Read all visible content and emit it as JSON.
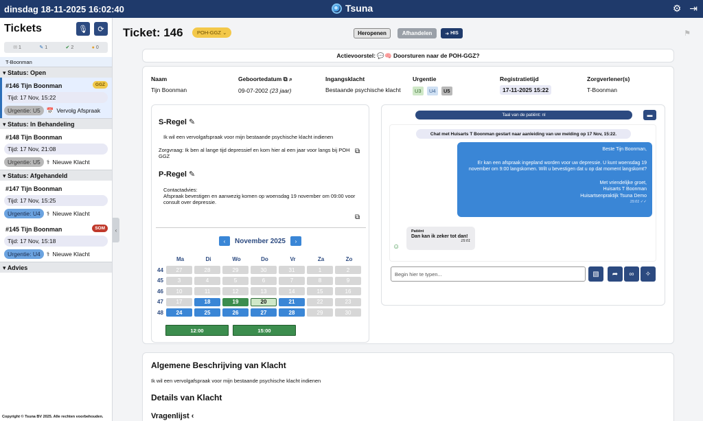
{
  "topbar": {
    "datetime": "dinsdag 18-11-2025 16:02:40",
    "app_name": "Tsuna"
  },
  "sidebar": {
    "title": "Tickets",
    "counters": {
      "mail": "1",
      "edit": "1",
      "ok": "2",
      "lock": "0"
    },
    "user": "T-Boonman",
    "sections": {
      "open": "Status: Open",
      "behandeling": "Status: In Behandeling",
      "afgehandeld": "Status: Afgehandeld",
      "advies": "Advies"
    },
    "tickets": [
      {
        "name": "#146 Tijn Boonman",
        "time": "Tijd: 17 Nov, 15:22",
        "urgency": "Urgentie: U5",
        "type": "Vervolg Afspraak",
        "badge": "GGZ"
      },
      {
        "name": "#148 Tijn Boonman",
        "time": "Tijd: 17 Nov, 21:08",
        "urgency": "Urgentie: U5",
        "type": "Nieuwe Klacht",
        "badge": ""
      },
      {
        "name": "#147 Tijn Boonman",
        "time": "Tijd: 17 Nov, 15:25",
        "urgency": "Urgentie: U4",
        "type": "Nieuwe Klacht",
        "badge": ""
      },
      {
        "name": "#145 Tijn Boonman",
        "time": "Tijd: 17 Nov, 15:18",
        "urgency": "Urgentie: U4",
        "type": "Nieuwe Klacht",
        "badge": "SOM"
      }
    ],
    "copyright": "Copyright © Tsuna BV 2025. Alle rechten voorbehouden."
  },
  "ticket": {
    "title": "Ticket: 146",
    "badge": "POH-GGZ",
    "buttons": {
      "heropen": "Heropenen",
      "afhandelen": "Afhandelen",
      "his": "HIS"
    },
    "actievoorstel": "Actievoorstel: 💬🧠 Doorsturen naar de POH-GGZ?"
  },
  "info": {
    "labels": {
      "naam": "Naam",
      "geboortedatum": "Geboortedatum",
      "ingangsklacht": "Ingangsklacht",
      "urgentie": "Urgentie",
      "registratietijd": "Registratietijd",
      "zorgverlener": "Zorgverlener(s)"
    },
    "naam": "Tijn Boonman",
    "geboortedatum": "09-07-2002",
    "leeftijd": "(23 jaar)",
    "ingangsklacht": "Bestaande psychische klacht",
    "urgentie_levels": [
      "U3",
      "U4",
      "U5"
    ],
    "registratietijd": "17-11-2025 15:22",
    "zorgverlener": "T-Boonman"
  },
  "sregel": {
    "title": "S-Regel",
    "line1": "Ik wil een vervolgafspraak voor mijn bestaande psychische klacht indienen",
    "line2": "Zorgvraag: Ik ben al lange tijd depressief en kom hier al een jaar voor langs bij POH GGZ"
  },
  "pregel": {
    "title": "P-Regel",
    "line1": "Contactadvies:",
    "line2": "Afspraak bevestigen en aanwezig komen op woensdag 19 november om 09:00 voor consult over depressie."
  },
  "calendar": {
    "month": "November 2025",
    "day_headers": [
      "Ma",
      "Di",
      "Wo",
      "Do",
      "Vr",
      "Za",
      "Zo"
    ],
    "weeks": [
      {
        "wk": "44",
        "days": [
          [
            "27",
            "cur"
          ],
          [
            "28",
            "cur"
          ],
          [
            "29",
            "cur"
          ],
          [
            "30",
            "cur"
          ],
          [
            "31",
            "cur"
          ],
          [
            "1",
            "cur"
          ],
          [
            "2",
            "cur"
          ]
        ]
      },
      {
        "wk": "45",
        "days": [
          [
            "3",
            "cur"
          ],
          [
            "4",
            "cur"
          ],
          [
            "5",
            "cur"
          ],
          [
            "6",
            "cur"
          ],
          [
            "7",
            "cur"
          ],
          [
            "8",
            "cur"
          ],
          [
            "9",
            "cur"
          ]
        ]
      },
      {
        "wk": "46",
        "days": [
          [
            "10",
            "cur"
          ],
          [
            "11",
            "cur"
          ],
          [
            "12",
            "cur"
          ],
          [
            "13",
            "cur"
          ],
          [
            "14",
            "cur"
          ],
          [
            "15",
            "cur"
          ],
          [
            "16",
            "cur"
          ]
        ]
      },
      {
        "wk": "47",
        "days": [
          [
            "17",
            "cur"
          ],
          [
            "18",
            "avail"
          ],
          [
            "19",
            "green"
          ],
          [
            "20",
            "sel"
          ],
          [
            "21",
            "avail"
          ],
          [
            "22",
            "cur"
          ],
          [
            "23",
            "cur"
          ]
        ]
      },
      {
        "wk": "48",
        "days": [
          [
            "24",
            "avail"
          ],
          [
            "25",
            "avail"
          ],
          [
            "26",
            "avail"
          ],
          [
            "27",
            "avail"
          ],
          [
            "28",
            "avail"
          ],
          [
            "29",
            "cur"
          ],
          [
            "30",
            "cur"
          ]
        ]
      }
    ],
    "slots": [
      "12:00",
      "15:00"
    ]
  },
  "chat": {
    "language": "Taal van de patiënt: nl",
    "system": "Chat met Huisarts T Boonman gestart naar aanleiding van uw melding op 17 Nov, 15:22.",
    "outgoing": {
      "greeting": "Beste Tijn Boonman,",
      "body": "Er kan een afspraak ingepland worden voor uw depressie. U kunt woensdag 19 november om 9:00 langskomen. Wilt u bevestigen dat u op dat moment langskomt?",
      "closing1": "Met vriendelijke groet,",
      "closing2": "Huisarts T Boonman",
      "closing3": "Huisartsenpraktijk Tsuna Demo",
      "time": "15:01 ✓✓"
    },
    "incoming": {
      "sender": "Patiënt",
      "body": "Dan kan ik zeker tot dan!",
      "time": "15:01"
    },
    "placeholder": "Begin hier te typen..."
  },
  "description": {
    "title": "Algemene Beschrijving van Klacht",
    "text": "Ik wil een vervolgafspraak voor mijn bestaande psychische klacht indienen",
    "details_title": "Details van Klacht",
    "vragenlijst": "Vragenlijst"
  }
}
